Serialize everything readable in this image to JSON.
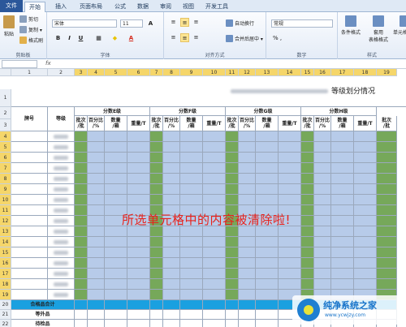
{
  "tabs": [
    "文件",
    "开始",
    "插入",
    "页面布局",
    "公式",
    "数据",
    "审阅",
    "视图",
    "开发工具"
  ],
  "clipboard": {
    "paste": "粘贴",
    "cut": "剪切",
    "copy": "复制 ▾",
    "format_painter": "格式刷",
    "label": "剪贴板"
  },
  "font": {
    "name": "宋体",
    "size": "11",
    "label": "字体"
  },
  "alignment": {
    "wrap": "自动换行",
    "merge": "合并后居中 ▾",
    "label": "对齐方式"
  },
  "number": {
    "format": "常规",
    "percent": "% ,",
    "label": "数字"
  },
  "styles": {
    "conditional": "条件格式",
    "table": "套用\n表格格式",
    "cell_styles": "单元格样式",
    "label": "样式"
  },
  "formula_bar": {
    "fx": "fx"
  },
  "columns": [
    "1",
    "2",
    "3",
    "4",
    "5",
    "6",
    "7",
    "8",
    "9",
    "10",
    "11",
    "12",
    "13",
    "14",
    "15",
    "16",
    "17",
    "18",
    "19"
  ],
  "rows": [
    "1",
    "2",
    "3",
    "4",
    "5",
    "6",
    "7",
    "8",
    "9",
    "10",
    "11",
    "12",
    "13",
    "14",
    "15",
    "16",
    "17",
    "18",
    "19",
    "20",
    "21",
    "22"
  ],
  "sheet": {
    "title_suffix": "等级划分情况",
    "col_brand": "牌号",
    "col_grade": "等级",
    "groups": [
      "分数E级",
      "分数F级",
      "分数G级",
      "分数H级"
    ],
    "sub_batch": "批次\n/批",
    "sub_percent": "百分比\n/%",
    "sub_count": "数量\n/箱",
    "sub_weight": "重量/T",
    "sub_batch_short": "批次\n/批",
    "row_total": "合格品合计",
    "row_out": "等外品",
    "row_reject": "待检品"
  },
  "message": "所选单元格中的内容被清除啦!",
  "watermark": {
    "name": "纯净系统之家",
    "url": "www.ycwjzy.com"
  },
  "colors": {
    "accent": "#2b579a",
    "green": "#76a85a",
    "blue": "#b7cbe9",
    "total": "#1aa0e0",
    "message": "#e8221c"
  }
}
